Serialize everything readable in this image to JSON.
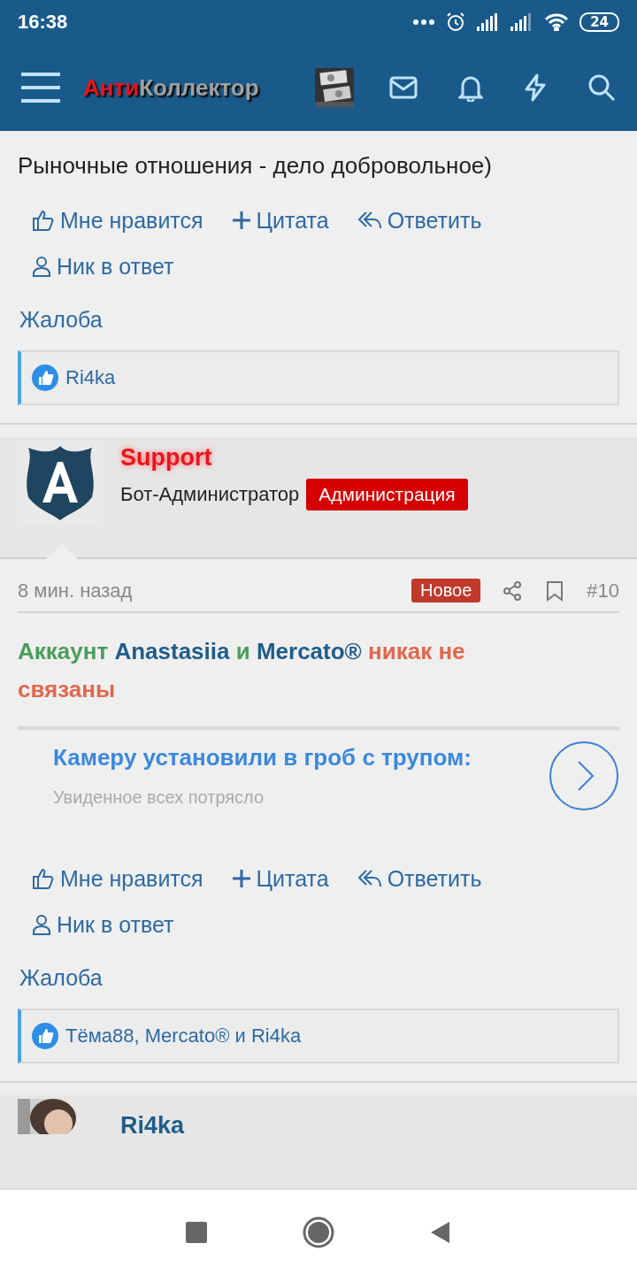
{
  "status_bar": {
    "time": "16:38",
    "battery": "24"
  },
  "app_bar": {
    "logo": [
      {
        "text": "Анти",
        "color": "#e8141c"
      },
      {
        "text": "Коллектор",
        "color": "#a0a0a0"
      }
    ]
  },
  "post_end": {
    "body": "Рыночные отношения - дело добровольное)",
    "actions": [
      {
        "kind": "like",
        "label": "Мне нравится"
      },
      {
        "kind": "quote",
        "label": "Цитата"
      },
      {
        "kind": "reply",
        "label": "Ответить"
      },
      {
        "kind": "nick",
        "label": "Ник в ответ"
      }
    ],
    "report": "Жалоба",
    "reactions": "Ri4ka"
  },
  "post": {
    "author": "Support",
    "user_title": "Бот-Администратор",
    "role_badge": "Администрация",
    "time": "8 мин. назад",
    "new_badge": "Новое",
    "number": "#10",
    "body": [
      {
        "text": "Аккаунт",
        "color": "#4a9d5b"
      },
      {
        "text": "Anastasiia",
        "color": "#1f5d8b"
      },
      {
        "text": "и",
        "color": "#4a9d5b"
      },
      {
        "text": "Mercato®",
        "color": "#1f5d8b"
      },
      {
        "text": "никак не связаны",
        "color": "#e0684f"
      }
    ],
    "ad": {
      "title": "Камеру установили в гроб с трупом:",
      "subtitle": "Увиденное всех потрясло"
    },
    "actions": [
      {
        "kind": "like",
        "label": "Мне нравится"
      },
      {
        "kind": "quote",
        "label": "Цитата"
      },
      {
        "kind": "reply",
        "label": "Ответить"
      },
      {
        "kind": "nick",
        "label": "Ник в ответ"
      }
    ],
    "report": "Жалоба",
    "reactions": "Тёма88, Mercato® и Ri4ka"
  },
  "next_post": {
    "author": "Ri4ka"
  }
}
